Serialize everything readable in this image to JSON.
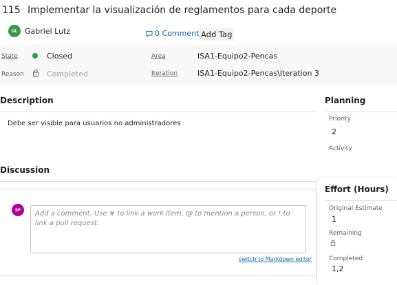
{
  "work_item": {
    "id": "115",
    "title": "Implementar la visualización de reglamentos para cada deporte"
  },
  "owner": {
    "initials": "GL",
    "name": "Gabriel Lutz",
    "avatar_color": "#339947"
  },
  "comments_link": {
    "label": "0 Comments",
    "icon": "comment-icon"
  },
  "add_tag_label": "Add Tag",
  "fields": {
    "state_label": "State",
    "state_value": "Closed",
    "state_color": "#339947",
    "reason_label": "Reason",
    "reason_value": "Completed",
    "area_label": "Area",
    "area_value": "ISA1-Equipo2-Pencas",
    "iteration_label": "Iteration",
    "iteration_value": "ISA1-Equipo2-Pencas\\Iteration 3"
  },
  "description": {
    "title": "Description",
    "body": "Debe ser visible para usuarios no administradores"
  },
  "discussion": {
    "title": "Discussion",
    "commenter_initials": "SF",
    "commenter_color": "#b4009e",
    "placeholder": "Add a comment. Use # to link a work item, @ to mention a person, or ! to link a pull request.",
    "markdown_link": "switch to Markdown editor"
  },
  "planning": {
    "title": "Planning",
    "priority_label": "Priority",
    "priority_value": "2",
    "activity_label": "Activity"
  },
  "effort": {
    "title": "Effort (Hours)",
    "original_label": "Original Estimate",
    "original_value": "1",
    "remaining_label": "Remaining",
    "completed_label": "Completed",
    "completed_value": "1,2"
  }
}
